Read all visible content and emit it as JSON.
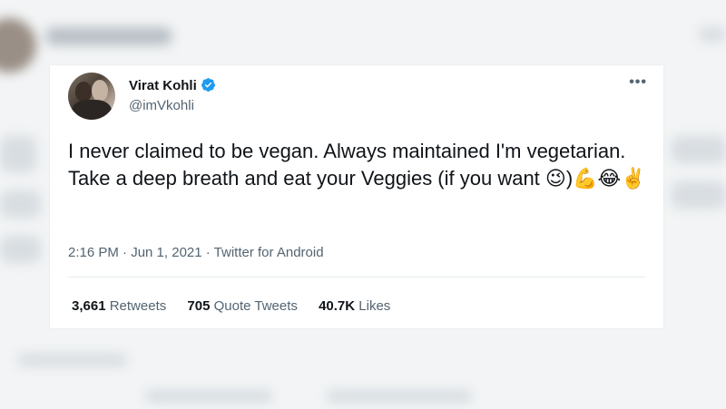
{
  "tweet": {
    "author_name": "Virat Kohli",
    "handle": "@imVkohli",
    "text": "I never claimed to be vegan. Always maintained I'm vegetarian. Take a deep breath and eat your Veggies (if you want 😉)💪😂✌️",
    "timestamp": "2:16 PM · Jun 1, 2021",
    "source": "Twitter for Android",
    "more_icon": "more-horizontal-icon",
    "verified_color": "#1d9bf0"
  },
  "stats": {
    "retweets_count": "3,661",
    "retweets_label": "Retweets",
    "quotes_count": "705",
    "quotes_label": "Quote Tweets",
    "likes_count": "40.7K",
    "likes_label": "Likes"
  }
}
